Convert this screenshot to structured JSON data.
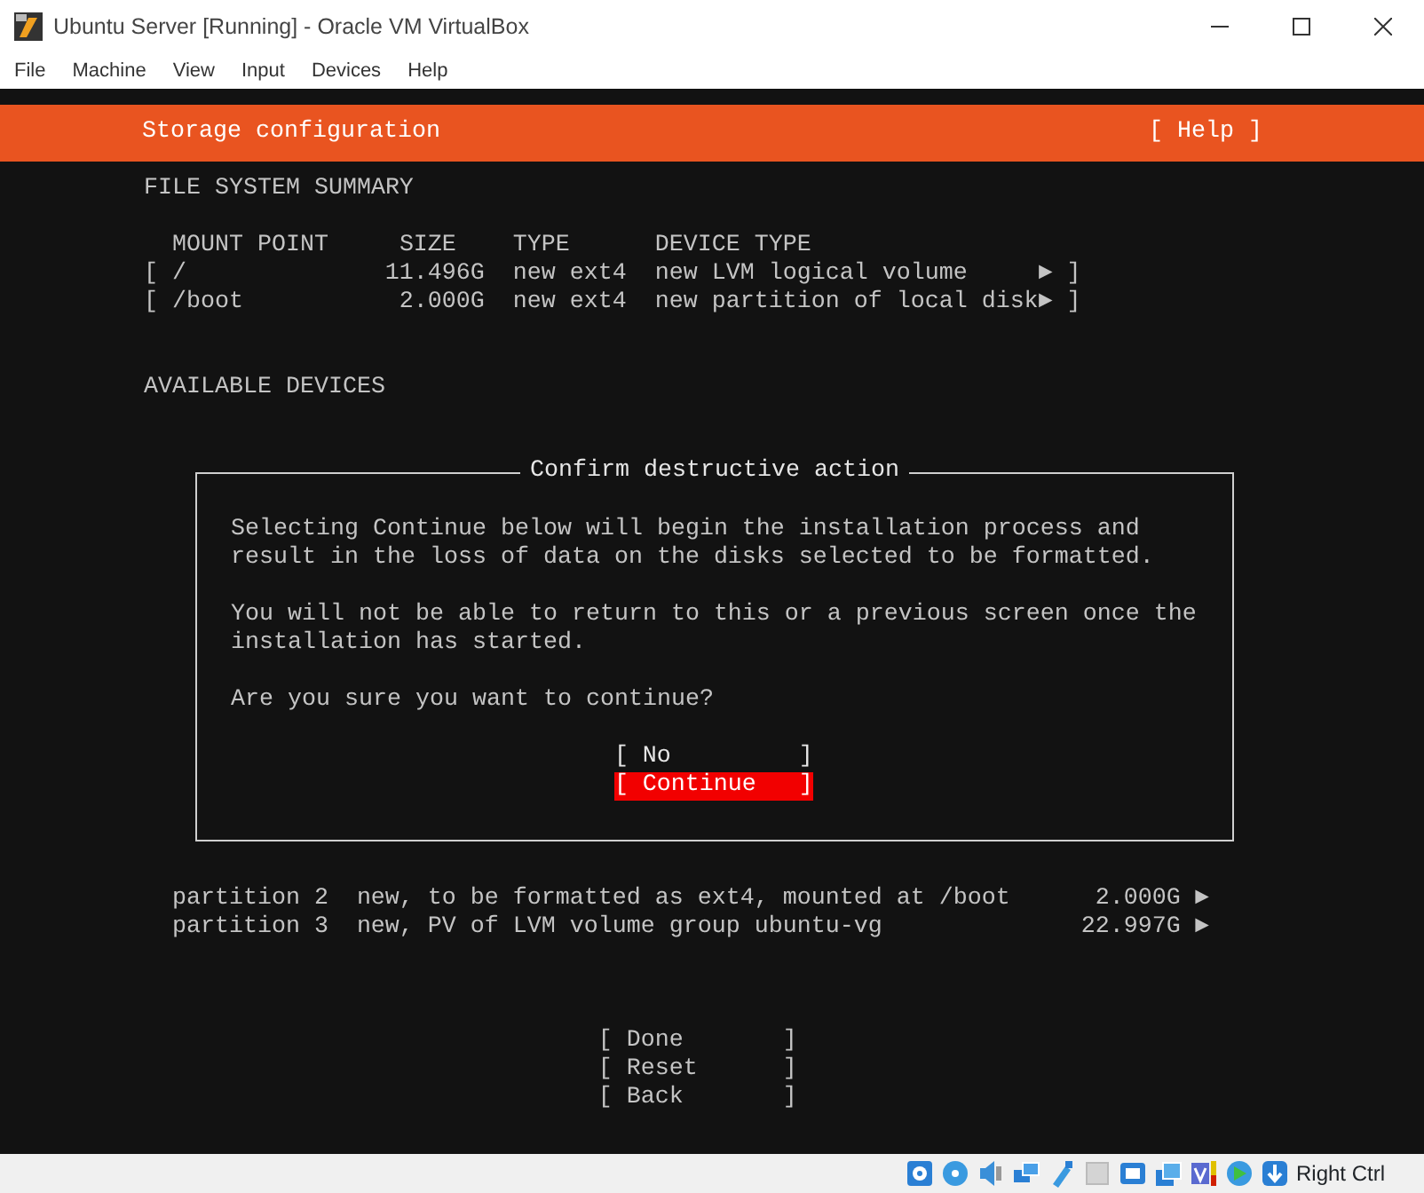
{
  "window": {
    "title": "Ubuntu Server [Running] - Oracle VM VirtualBox"
  },
  "menu": [
    "File",
    "Machine",
    "View",
    "Input",
    "Devices",
    "Help"
  ],
  "header": {
    "title": "Storage configuration",
    "help": "[ Help ]"
  },
  "summary": {
    "heading": "FILE SYSTEM SUMMARY",
    "columns": [
      "MOUNT POINT",
      "SIZE",
      "TYPE",
      "DEVICE TYPE"
    ],
    "rows": [
      {
        "open": "[",
        "mount": "/",
        "size": "11.496G",
        "type": "new ext4",
        "device": "new LVM logical volume",
        "arrow": "►",
        "close": "]"
      },
      {
        "open": "[",
        "mount": "/boot",
        "size": "2.000G",
        "type": "new ext4",
        "device": "new partition of local disk",
        "arrow": "►",
        "close": "]"
      }
    ]
  },
  "devices": {
    "heading": "AVAILABLE DEVICES",
    "rows": [
      {
        "name": "partition 2",
        "description": "new, to be formatted as ext4, mounted at /boot",
        "size": "2.000G",
        "arrow": "►"
      },
      {
        "name": "partition 3",
        "description": "new, PV of LVM volume group ubuntu-vg",
        "size": "22.997G",
        "arrow": "►"
      }
    ]
  },
  "dialog": {
    "title": "Confirm destructive action",
    "paragraphs": [
      [
        "Selecting Continue below will begin the installation process and",
        "result in the loss of data on the disks selected to be formatted."
      ],
      [
        "You will not be able to return to this or a previous screen once the",
        "installation has started."
      ],
      [
        "Are you sure you want to continue?"
      ]
    ],
    "buttons": [
      {
        "label": "[ No         ]",
        "selected": false
      },
      {
        "label": "[ Continue   ]",
        "selected": true
      }
    ]
  },
  "actions": [
    {
      "label": "[ Done       ]"
    },
    {
      "label": "[ Reset      ]"
    },
    {
      "label": "[ Back       ]"
    }
  ],
  "status_bar": {
    "host_key": "Right Ctrl"
  }
}
